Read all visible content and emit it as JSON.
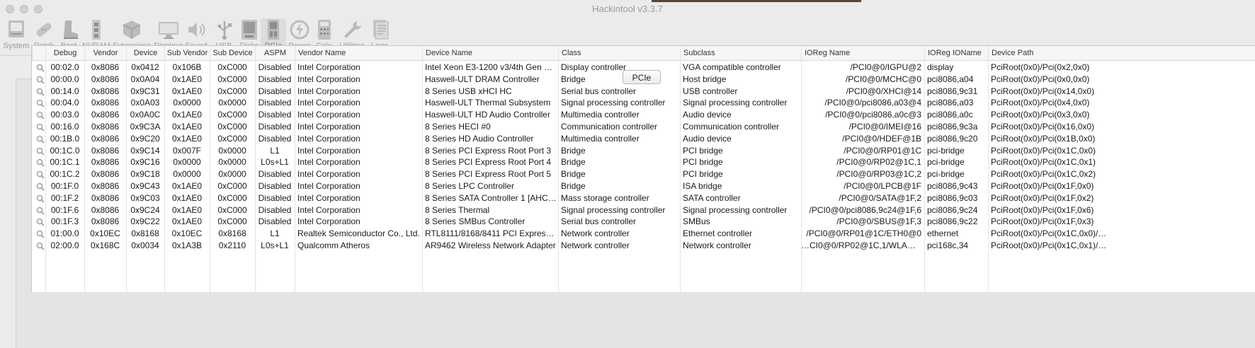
{
  "window": {
    "title": "Hackintool v3.3.7"
  },
  "toolbar": {
    "items": [
      {
        "label": "System",
        "icon": "system-icon"
      },
      {
        "label": "Patch",
        "icon": "patch-icon"
      },
      {
        "label": "Boot",
        "icon": "boot-icon"
      },
      {
        "label": "NVRAM",
        "icon": "nvram-icon"
      },
      {
        "label": "Extensions",
        "icon": "extensions-icon"
      },
      {
        "label": "Displays",
        "icon": "displays-icon"
      },
      {
        "label": "Sound",
        "icon": "sound-icon"
      },
      {
        "label": "USB",
        "icon": "usb-icon"
      },
      {
        "label": "Disks",
        "icon": "disks-icon"
      },
      {
        "label": "PCIe",
        "icon": "pcie-icon",
        "active": true
      },
      {
        "label": "Power",
        "icon": "power-icon"
      },
      {
        "label": "Calc",
        "icon": "calc-icon"
      },
      {
        "label": "Utilities",
        "icon": "utilities-icon"
      },
      {
        "label": "Logs",
        "icon": "logs-icon"
      }
    ]
  },
  "panel": {
    "tab_label": "PCIe"
  },
  "table": {
    "columns": [
      "",
      "Debug",
      "Vendor",
      "Device",
      "Sub Vendor",
      "Sub Device",
      "ASPM",
      "Vendor Name",
      "Device Name",
      "Class",
      "Subclass",
      "IOReg Name",
      "IOReg IOName",
      "Device Path"
    ],
    "rows": [
      [
        "00:02.0",
        "0x8086",
        "0x0412",
        "0x106B",
        "0xC000",
        "Disabled",
        "Intel Corporation",
        "Intel Xeon E3-1200 v3/4th Gen Cor…",
        "Display controller",
        "VGA compatible controller",
        "/PCI0@0/IGPU@2",
        "display",
        "PciRoot(0x0)/Pci(0x2,0x0)"
      ],
      [
        "00:00.0",
        "0x8086",
        "0x0A04",
        "0x1AE0",
        "0xC000",
        "Disabled",
        "Intel Corporation",
        "Haswell-ULT DRAM Controller",
        "Bridge",
        "Host bridge",
        "/PCI0@0/MCHC@0",
        "pci8086,a04",
        "PciRoot(0x0)/Pci(0x0,0x0)"
      ],
      [
        "00:14.0",
        "0x8086",
        "0x9C31",
        "0x1AE0",
        "0xC000",
        "Disabled",
        "Intel Corporation",
        "8 Series USB xHCI HC",
        "Serial bus controller",
        "USB controller",
        "/PCI0@0/XHCI@14",
        "pci8086,9c31",
        "PciRoot(0x0)/Pci(0x14,0x0)"
      ],
      [
        "00:04.0",
        "0x8086",
        "0x0A03",
        "0x0000",
        "0x0000",
        "Disabled",
        "Intel Corporation",
        "Haswell-ULT Thermal Subsystem",
        "Signal processing controller",
        "Signal processing controller",
        "/PCI0@0/pci8086,a03@4",
        "pci8086,a03",
        "PciRoot(0x0)/Pci(0x4,0x0)"
      ],
      [
        "00:03.0",
        "0x8086",
        "0x0A0C",
        "0x1AE0",
        "0xC000",
        "Disabled",
        "Intel Corporation",
        "Haswell-ULT HD Audio Controller",
        "Multimedia controller",
        "Audio device",
        "/PCI0@0/pci8086,a0c@3",
        "pci8086,a0c",
        "PciRoot(0x0)/Pci(0x3,0x0)"
      ],
      [
        "00:16.0",
        "0x8086",
        "0x9C3A",
        "0x1AE0",
        "0xC000",
        "Disabled",
        "Intel Corporation",
        "8 Series HECI #0",
        "Communication controller",
        "Communication controller",
        "/PCI0@0/IMEI@16",
        "pci8086,9c3a",
        "PciRoot(0x0)/Pci(0x16,0x0)"
      ],
      [
        "00:1B.0",
        "0x8086",
        "0x9C20",
        "0x1AE0",
        "0xC000",
        "Disabled",
        "Intel Corporation",
        "8 Series HD Audio Controller",
        "Multimedia controller",
        "Audio device",
        "/PCI0@0/HDEF@1B",
        "pci8086,9c20",
        "PciRoot(0x0)/Pci(0x1B,0x0)"
      ],
      [
        "00:1C.0",
        "0x8086",
        "0x9C14",
        "0x007F",
        "0x0000",
        "L1",
        "Intel Corporation",
        "8 Series PCI Express Root Port 3",
        "Bridge",
        "PCI bridge",
        "/PCI0@0/RP01@1C",
        "pci-bridge",
        "PciRoot(0x0)/Pci(0x1C,0x0)"
      ],
      [
        "00:1C.1",
        "0x8086",
        "0x9C16",
        "0x0000",
        "0x0000",
        "L0s+L1",
        "Intel Corporation",
        "8 Series PCI Express Root Port 4",
        "Bridge",
        "PCI bridge",
        "/PCI0@0/RP02@1C,1",
        "pci-bridge",
        "PciRoot(0x0)/Pci(0x1C,0x1)"
      ],
      [
        "00:1C.2",
        "0x8086",
        "0x9C18",
        "0x0000",
        "0x0000",
        "Disabled",
        "Intel Corporation",
        "8 Series PCI Express Root Port 5",
        "Bridge",
        "PCI bridge",
        "/PCI0@0/RP03@1C,2",
        "pci-bridge",
        "PciRoot(0x0)/Pci(0x1C,0x2)"
      ],
      [
        "00:1F.0",
        "0x8086",
        "0x9C43",
        "0x1AE0",
        "0xC000",
        "Disabled",
        "Intel Corporation",
        "8 Series LPC Controller",
        "Bridge",
        "ISA bridge",
        "/PCI0@0/LPCB@1F",
        "pci8086,9c43",
        "PciRoot(0x0)/Pci(0x1F,0x0)"
      ],
      [
        "00:1F.2",
        "0x8086",
        "0x9C03",
        "0x1AE0",
        "0xC000",
        "Disabled",
        "Intel Corporation",
        "8 Series SATA Controller 1 [AHCI m…",
        "Mass storage controller",
        "SATA controller",
        "/PCI0@0/SATA@1F,2",
        "pci8086,9c03",
        "PciRoot(0x0)/Pci(0x1F,0x2)"
      ],
      [
        "00:1F.6",
        "0x8086",
        "0x9C24",
        "0x1AE0",
        "0xC000",
        "Disabled",
        "Intel Corporation",
        "8 Series Thermal",
        "Signal processing controller",
        "Signal processing controller",
        "/PCI0@0/pci8086,9c24@1F,6",
        "pci8086,9c24",
        "PciRoot(0x0)/Pci(0x1F,0x6)"
      ],
      [
        "00:1F.3",
        "0x8086",
        "0x9C22",
        "0x1AE0",
        "0xC000",
        "Disabled",
        "Intel Corporation",
        "8 Series SMBus Controller",
        "Serial bus controller",
        "SMBus",
        "/PCI0@0/SBUS@1F,3",
        "pci8086,9c22",
        "PciRoot(0x0)/Pci(0x1F,0x3)"
      ],
      [
        "01:00.0",
        "0x10EC",
        "0x8168",
        "0x10EC",
        "0x8168",
        "L1",
        "Realtek Semiconductor Co., Ltd.",
        "RTL8111/8168/8411 PCI Express Gi…",
        "Network controller",
        "Ethernet controller",
        "/PCI0@0/RP01@1C/ETH0@0",
        "ethernet",
        "PciRoot(0x0)/Pci(0x1C,0x0)/…"
      ],
      [
        "02:00.0",
        "0x168C",
        "0x0034",
        "0x1A3B",
        "0x2110",
        "L0s+L1",
        "Qualcomm Atheros",
        "AR9462 Wireless Network Adapter",
        "Network controller",
        "Network controller",
        "…CI0@0/RP02@1C,1/WLAN@0",
        "pci168c,34",
        "PciRoot(0x0)/Pci(0x1C,0x1)/…"
      ]
    ]
  }
}
